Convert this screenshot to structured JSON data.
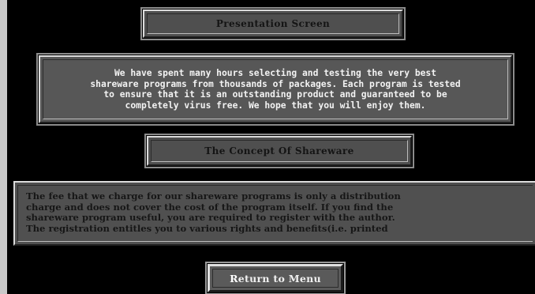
{
  "header": {
    "title": "Presentation Screen"
  },
  "intro": {
    "text": "We have spent many hours selecting and testing the very best\nshareware programs from thousands of packages. Each program is tested\nto ensure that it is an outstanding product and guaranteed to be\ncompletely virus free. We hope that you will enjoy them."
  },
  "section": {
    "title": "The Concept Of Shareware"
  },
  "fee": {
    "text": "The fee that we charge for our shareware programs is only a distribution\ncharge and does not cover the cost of the program itself. If you find the\nshareware program useful, you are required to register with the author.\nThe registration entitles you to various rights and benefits(i.e. printed"
  },
  "buttons": {
    "return_hotkey": "R",
    "return_rest": "eturn to Menu"
  }
}
